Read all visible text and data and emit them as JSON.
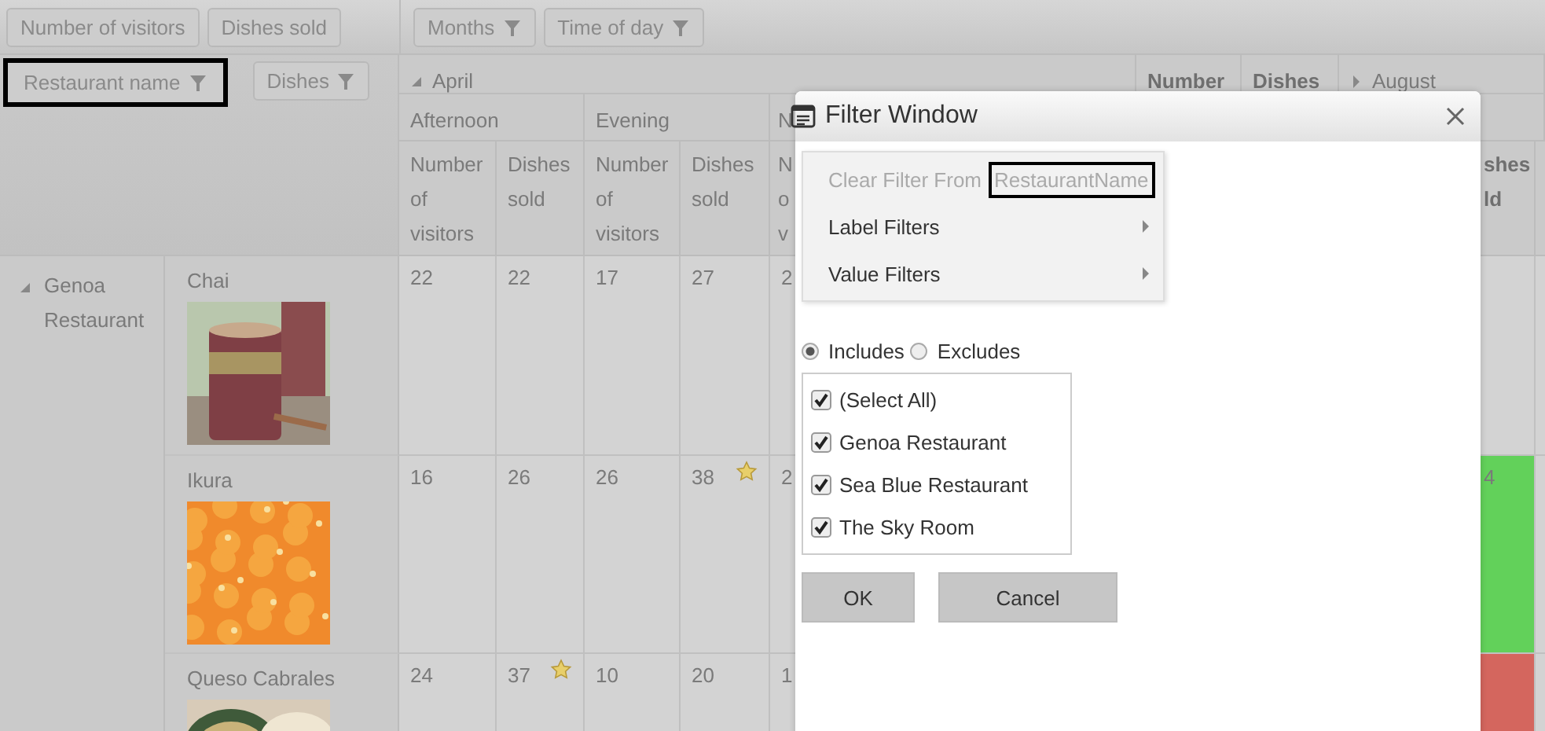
{
  "field_list": {
    "values_fields": [
      {
        "label": "Number of visitors",
        "filter": false,
        "highlighted": false
      },
      {
        "label": "Dishes sold",
        "filter": false,
        "highlighted": false
      }
    ],
    "column_fields": [
      {
        "label": "Months",
        "filter": true,
        "highlighted": false
      },
      {
        "label": "Time of day",
        "filter": true,
        "highlighted": false
      }
    ],
    "row_fields": [
      {
        "label": "Restaurant name",
        "filter": true,
        "highlighted": true
      },
      {
        "label": "Dishes",
        "filter": true,
        "highlighted": false
      }
    ]
  },
  "pivot": {
    "month": {
      "label": "April",
      "expanded": true
    },
    "totals": [
      "Number",
      "Dishes"
    ],
    "next_month": {
      "label": "August",
      "expanded": false
    },
    "time_groups": [
      "Afternoon",
      "Evening"
    ],
    "clipped_group": "N",
    "measures": [
      "Number of visitors",
      "Dishes sold",
      "Number of visitors",
      "Dishes sold"
    ],
    "clipped_measure": "N o v",
    "right_measure": "shes ld",
    "restaurant": {
      "label": "Genoa Restaurant",
      "expanded": true
    },
    "rows": [
      {
        "dish": "Chai",
        "cells": [
          {
            "value": "22",
            "starred": false
          },
          {
            "value": "22",
            "starred": false
          },
          {
            "value": "17",
            "starred": false
          },
          {
            "value": "27",
            "starred": false
          }
        ],
        "clipped": "2",
        "right": {}
      },
      {
        "dish": "Ikura",
        "cells": [
          {
            "value": "16",
            "starred": false
          },
          {
            "value": "26",
            "starred": false
          },
          {
            "value": "26",
            "starred": false
          },
          {
            "value": "38",
            "starred": true
          }
        ],
        "clipped": "2",
        "right": {
          "value": "4",
          "color": "#62d15a"
        }
      },
      {
        "dish": "Queso Cabrales",
        "cells": [
          {
            "value": "24",
            "starred": false
          },
          {
            "value": "37",
            "starred": true
          },
          {
            "value": "10",
            "starred": false
          },
          {
            "value": "20",
            "starred": false
          }
        ],
        "clipped": "1",
        "right": {
          "color": "#d4665e"
        }
      }
    ]
  },
  "filter_window": {
    "title": "Filter Window",
    "menu": [
      {
        "kind": "clear",
        "label": "Clear Filter From",
        "field": "RestaurantName",
        "highlighted": true,
        "disabled": true
      },
      {
        "kind": "submenu",
        "label": "Label Filters",
        "disabled": false
      },
      {
        "kind": "submenu",
        "label": "Value Filters",
        "disabled": false
      }
    ],
    "modes": [
      {
        "label": "Includes",
        "selected": true
      },
      {
        "label": "Excludes",
        "selected": false
      }
    ],
    "items": [
      {
        "label": "(Select All)",
        "checked": true
      },
      {
        "label": "Genoa Restaurant",
        "checked": true
      },
      {
        "label": "Sea Blue Restaurant",
        "checked": true
      },
      {
        "label": "The Sky Room",
        "checked": true
      }
    ],
    "buttons": [
      "OK",
      "Cancel"
    ]
  }
}
